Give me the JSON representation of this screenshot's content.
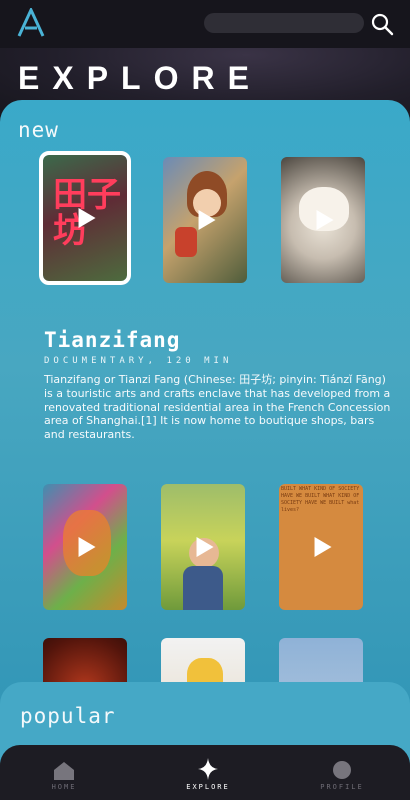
{
  "header": {
    "title": "EXPLORE",
    "logo_icon": "app-logo-icon",
    "search_icon": "search-icon"
  },
  "sections": {
    "new": "new",
    "popular": "popular"
  },
  "cards": [
    {
      "name": "Tianzifang",
      "selected": true
    },
    {
      "name": "anime-girl"
    },
    {
      "name": "dog"
    },
    {
      "name": "abstract-art"
    },
    {
      "name": "child-in-field"
    },
    {
      "name": "text-poster"
    },
    {
      "name": "neon"
    },
    {
      "name": "illustration"
    },
    {
      "name": "sky"
    }
  ],
  "card_glyph": "田子坊",
  "poster_text": "BUILT WHAT KIND OF SOCIETY HAVE WE BUILT WHAT KIND OF SOCIETY HAVE WE BUILT what lives?",
  "info": {
    "title": "Tianzifang",
    "meta": "DOCUMENTARY, 120 MIN",
    "description": "Tianzifang or Tianzi Fang (Chinese: 田子坊; pinyin: Tiánzǐ Fāng) is a touristic arts and crafts enclave that has developed from a renovated traditional residential area in the French Concession area of Shanghai.[1] It is now home to boutique shops, bars and restaurants."
  },
  "nav": {
    "home": "HOME",
    "explore": "EXPLORE",
    "profile": "PROFILE"
  },
  "colors": {
    "panel": "#3aa9c9",
    "background": "#15141b",
    "accent_logo": "#4ab3d6"
  }
}
